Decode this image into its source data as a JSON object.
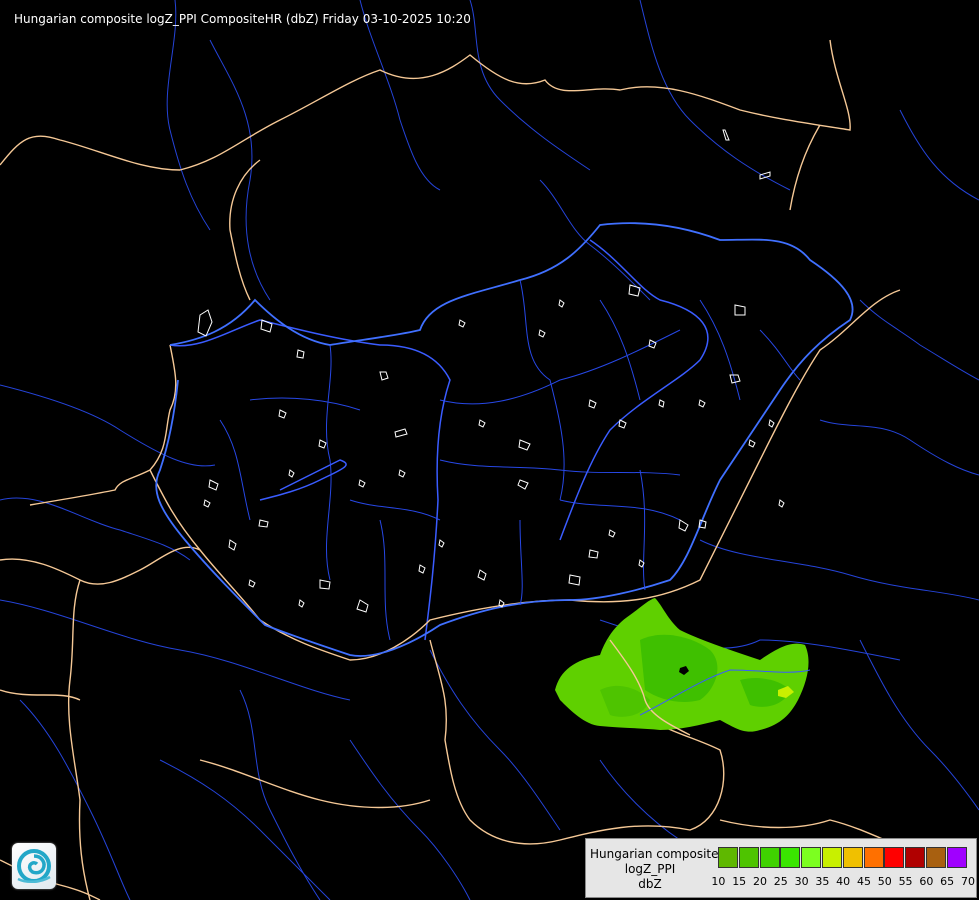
{
  "header": {
    "title": "Hungarian composite logZ_PPI CompositeHR (dbZ) Friday 03-10-2025 10:20"
  },
  "legend": {
    "line1": "Hungarian composite",
    "line2": "logZ_PPI",
    "line3": "dbZ",
    "levels": [
      "10",
      "15",
      "20",
      "25",
      "30",
      "35",
      "40",
      "45",
      "50",
      "55",
      "60",
      "65",
      "70"
    ],
    "colors": [
      "#5fb800",
      "#4ec400",
      "#3fd200",
      "#3ae600",
      "#7cff20",
      "#c8f000",
      "#f0c000",
      "#ff7000",
      "#ff0000",
      "#b00000",
      "#a86010",
      "#a000ff",
      "#b0b0ff"
    ]
  },
  "colors": {
    "background": "#000000",
    "country_border": "#f5c896",
    "rivers": "#2c50ff",
    "county_lines": "#ffffff",
    "precip_light": "#5fd000",
    "precip_mid": "#3fc000",
    "precip_peak": "#c8f000"
  },
  "icons": {
    "logo": "weather-service-logo"
  }
}
